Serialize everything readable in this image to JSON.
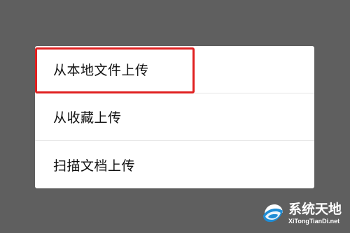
{
  "colors": {
    "overlay_background": "#5f5f5f",
    "menu_background": "#ffffff",
    "text_primary": "#111111",
    "divider": "#e7e7e7",
    "highlight": "#e02020",
    "watermark_text": "#ffffff",
    "watermark_logo_blue": "#1f8dd6"
  },
  "menu": {
    "items": [
      {
        "label": "从本地文件上传"
      },
      {
        "label": "从收藏上传"
      },
      {
        "label": "扫描文档上传"
      }
    ]
  },
  "watermark": {
    "title": "系统天地",
    "subtitle": "XiTongTianDi.net",
    "logo_icon": "system-tiandi-logo"
  }
}
